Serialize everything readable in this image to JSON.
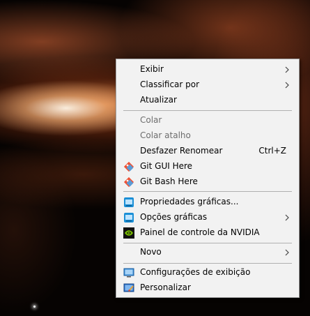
{
  "menu": {
    "groups": [
      {
        "items": [
          {
            "label": "Exibir",
            "submenu": true
          },
          {
            "label": "Classificar por",
            "submenu": true
          },
          {
            "label": "Atualizar"
          }
        ]
      },
      {
        "items": [
          {
            "label": "Colar",
            "disabled": true
          },
          {
            "label": "Colar atalho",
            "disabled": true
          },
          {
            "label": "Desfazer Renomear",
            "shortcut": "Ctrl+Z"
          },
          {
            "label": "Git GUI Here",
            "icon": "git-gui-icon"
          },
          {
            "label": "Git Bash Here",
            "icon": "git-bash-icon"
          }
        ]
      },
      {
        "items": [
          {
            "label": "Propriedades gráficas...",
            "icon": "intel-graphics-icon"
          },
          {
            "label": "Opções gráficas",
            "icon": "intel-graphics-options-icon",
            "submenu": true
          },
          {
            "label": "Painel de controle da NVIDIA",
            "icon": "nvidia-icon"
          }
        ]
      },
      {
        "items": [
          {
            "label": "Novo",
            "submenu": true
          }
        ]
      },
      {
        "items": [
          {
            "label": "Configurações de exibição",
            "icon": "display-settings-icon"
          },
          {
            "label": "Personalizar",
            "icon": "personalize-icon"
          }
        ]
      }
    ]
  },
  "colors": {
    "menu_background": "#f2f2f2",
    "menu_border": "#a0a0a0",
    "disabled_text": "#6d6d6d",
    "nvidia_green": "#76b900",
    "git_orange": "#f05133"
  }
}
